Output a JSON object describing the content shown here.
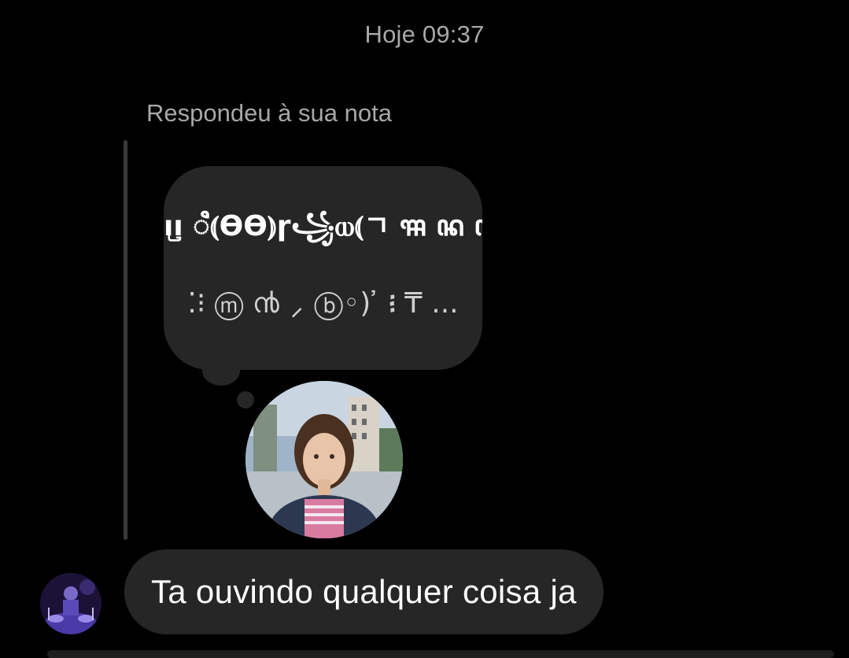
{
  "conversation": {
    "timestamp": "Hoje 09:37",
    "reply_context": "Respondeu à sua nota"
  },
  "note": {
    "line_1": "ıı꤬ ꦶ⦅ϴϴ⦆ɼ꧁ⲱ⦅ㄱ ꦯ ꦤ ꦡ..",
    "line_2": "⁚⁝ ⓜ ൯ ⸝ ⓑ◦) ҆ ᎒ ₸ ..."
  },
  "message": {
    "text": "Ta ouvindo qualquer coisa ja"
  },
  "colors": {
    "background": "#000000",
    "bubble": "#262626",
    "secondary_text": "#a8a8a8",
    "primary_text": "#ffffff"
  },
  "icons": {
    "note_avatar": "profile-photo",
    "sender_avatar": "profile-photo"
  }
}
